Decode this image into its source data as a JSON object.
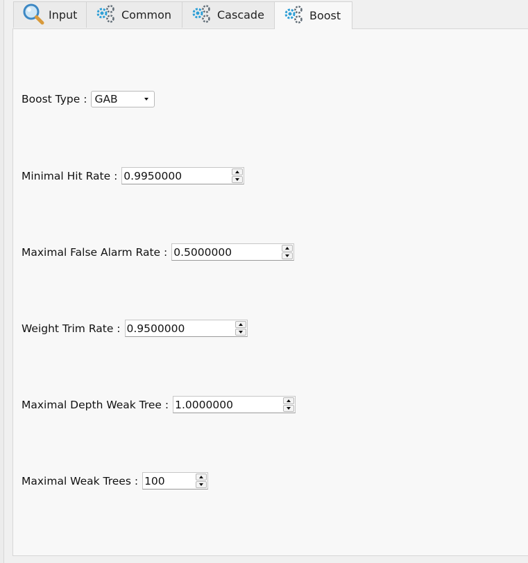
{
  "tabs": [
    {
      "label": "Input",
      "icon": "search-icon",
      "active": false
    },
    {
      "label": "Common",
      "icon": "gears-icon",
      "active": false
    },
    {
      "label": "Cascade",
      "icon": "gears-icon",
      "active": false
    },
    {
      "label": "Boost",
      "icon": "gears-icon",
      "active": true
    }
  ],
  "boost": {
    "boost_type": {
      "label": "Boost Type :",
      "value": "GAB"
    },
    "min_hit_rate": {
      "label": "Minimal Hit Rate :",
      "value": "0.9950000"
    },
    "max_false_alarm": {
      "label": "Maximal False Alarm Rate :",
      "value": "0.5000000"
    },
    "weight_trim": {
      "label": "Weight Trim Rate :",
      "value": "0.9500000"
    },
    "max_depth": {
      "label": "Maximal Depth Weak Tree :",
      "value": "1.0000000"
    },
    "max_weak_trees": {
      "label": "Maximal Weak Trees :",
      "value": "100"
    }
  },
  "colors": {
    "gear_blue": "#2e9fd6",
    "gear_gray": "#5f6b75",
    "magnifier_blue": "#3c88c4",
    "magnifier_handle": "#d89a3c"
  }
}
